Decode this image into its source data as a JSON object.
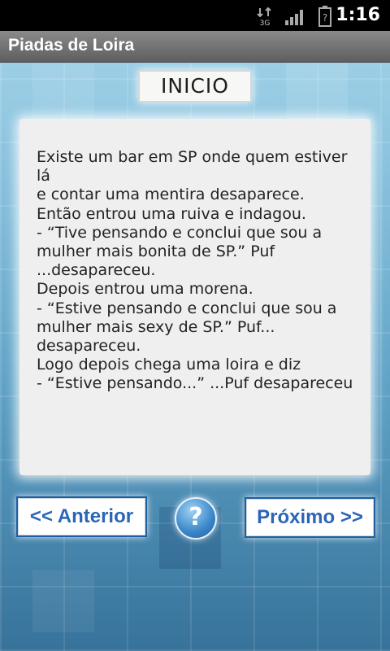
{
  "status_bar": {
    "network_type": "3G",
    "time": "1:16",
    "icons": [
      "network-3g-icon",
      "signal-icon",
      "battery-icon"
    ]
  },
  "app": {
    "title": "Piadas de Loira"
  },
  "header": {
    "label": "INICIO"
  },
  "joke": {
    "text": "Existe um bar em SP onde quem estiver lá\ne contar uma mentira desaparece.\nEntão entrou uma ruiva e indagou.\n- “Tive pensando e conclui que sou a\nmulher mais bonita de SP.” Puf\n...desapareceu.\nDepois entrou uma morena.\n- “Estive pensando e conclui que sou a\nmulher mais sexy de SP.” Puf...\ndesapareceu.\nLogo depois chega uma loira e diz\n- “Estive pensando...” ...Puf desapareceu"
  },
  "nav": {
    "prev_label": "<< Anterior",
    "help_label": "?",
    "next_label": "Próximo >>"
  },
  "colors": {
    "button_text": "#2a66b5",
    "background_blue": "#5a9ec2",
    "panel": "#efefef"
  }
}
